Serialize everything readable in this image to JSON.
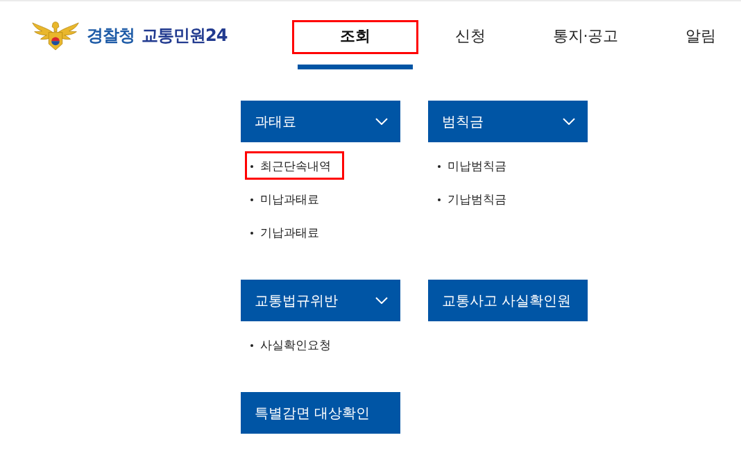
{
  "header": {
    "logo": {
      "agency": "경찰청",
      "service": "교통민원24"
    }
  },
  "nav": [
    {
      "label": "조회",
      "selected": true,
      "highlighted": true
    },
    {
      "label": "신청",
      "selected": false,
      "highlighted": false
    },
    {
      "label": "통지·공고",
      "selected": false,
      "highlighted": false
    },
    {
      "label": "알림",
      "selected": false,
      "highlighted": false
    }
  ],
  "menu": [
    {
      "title": "과태료",
      "dropdown": true,
      "items": [
        {
          "label": "최근단속내역",
          "highlighted": true
        },
        {
          "label": "미납과태료",
          "highlighted": false
        },
        {
          "label": "기납과태료",
          "highlighted": false
        }
      ]
    },
    {
      "title": "범칙금",
      "dropdown": true,
      "items": [
        {
          "label": "미납범칙금",
          "highlighted": false
        },
        {
          "label": "기납범칙금",
          "highlighted": false
        }
      ]
    },
    {
      "title": "교통법규위반",
      "dropdown": true,
      "items": [
        {
          "label": "사실확인요청",
          "highlighted": false
        }
      ]
    },
    {
      "title": "교통사고 사실확인원",
      "dropdown": false
    },
    {
      "title": "특별감면 대상확인",
      "dropdown": false
    }
  ]
}
